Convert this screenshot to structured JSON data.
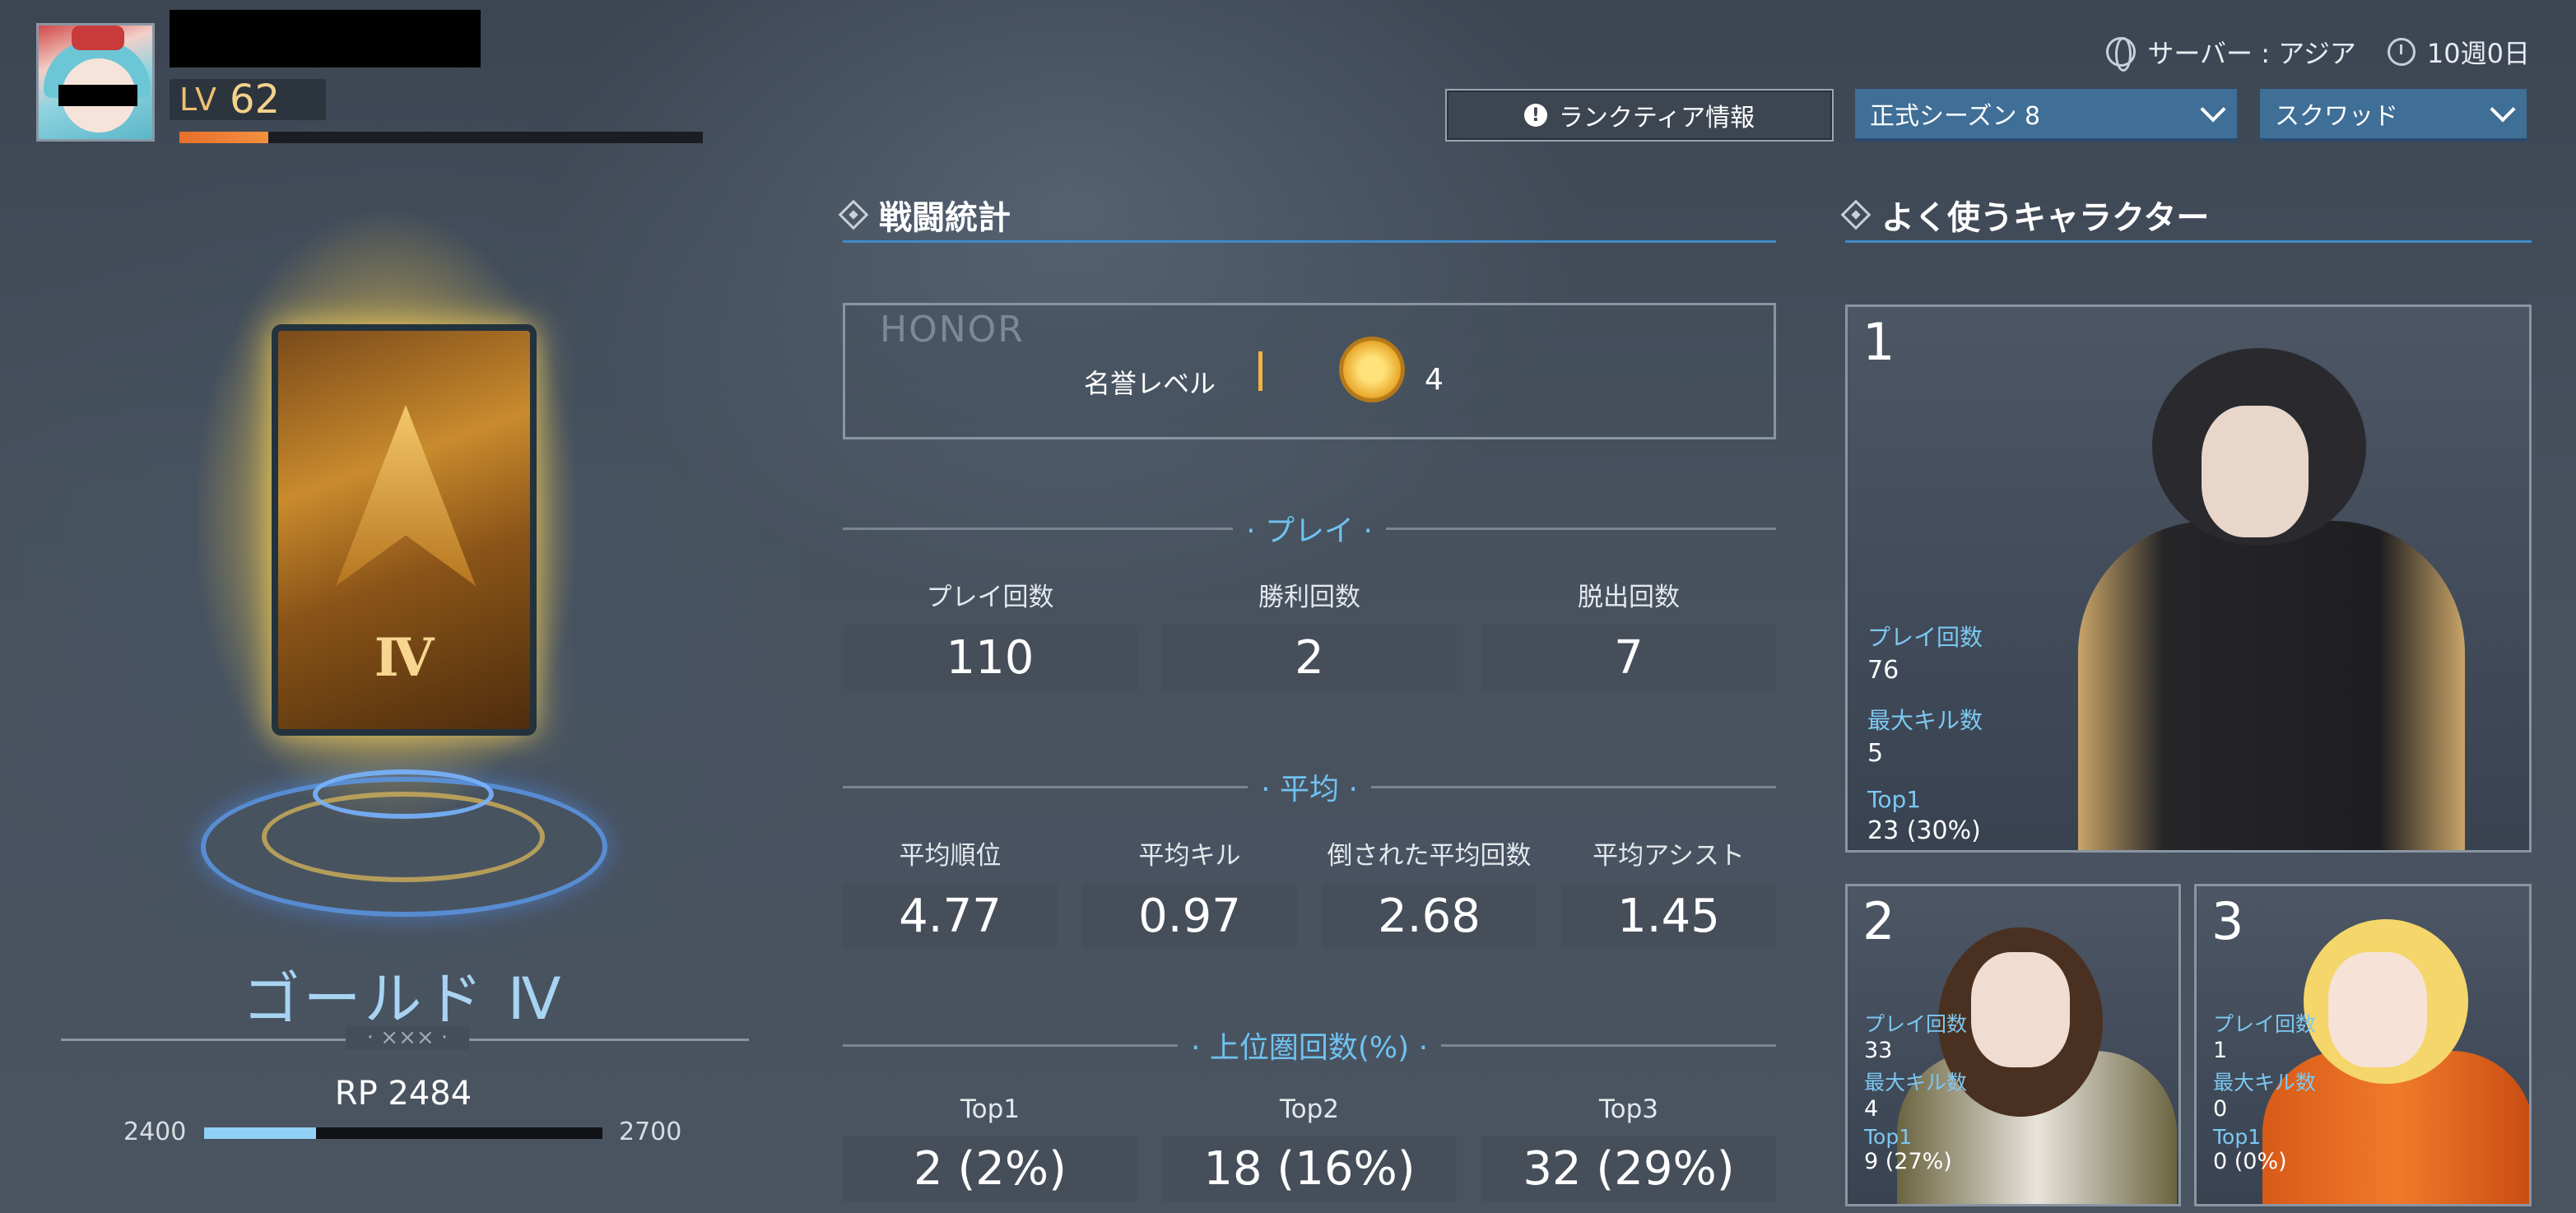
{
  "player": {
    "level_label": "LV",
    "level": "62",
    "xp_progress": 0.17
  },
  "header": {
    "server": "サーバー : アジア",
    "season_time": "10週0日",
    "rank_tier_button": "ランクティア情報",
    "season_select": "正式シーズン 8",
    "mode_select": "スクワッド"
  },
  "rank": {
    "card_numeral": "Ⅳ",
    "name": "ゴールド Ⅳ",
    "divider": "· ××× ·",
    "rp": "RP 2484",
    "rp_min": "2400",
    "rp_max": "2700",
    "rp_progress": 0.28
  },
  "stats": {
    "title": "戦闘統計",
    "honor_tag": "HONOR",
    "honor_label": "名誉レベル",
    "honor_level": "4",
    "play_section": "· プレイ ·",
    "play": [
      {
        "label": "プレイ回数",
        "value": "110"
      },
      {
        "label": "勝利回数",
        "value": "2"
      },
      {
        "label": "脱出回数",
        "value": "7"
      }
    ],
    "avg_section": "· 平均 ·",
    "avg": [
      {
        "label": "平均順位",
        "value": "4.77"
      },
      {
        "label": "平均キル",
        "value": "0.97"
      },
      {
        "label": "倒された平均回数",
        "value": "2.68"
      },
      {
        "label": "平均アシスト",
        "value": "1.45"
      }
    ],
    "top_section": "· 上位圏回数(%) ·",
    "top": [
      {
        "label": "Top1",
        "value": "2 (2%)"
      },
      {
        "label": "Top2",
        "value": "18 (16%)"
      },
      {
        "label": "Top3",
        "value": "32 (29%)"
      }
    ]
  },
  "characters": {
    "title": "よく使うキャラクター",
    "play_label": "プレイ回数",
    "maxkill_label": "最大キル数",
    "top1_label": "Top1",
    "list": [
      {
        "rank": "1",
        "plays": "76",
        "max_kills": "5",
        "top1": "23 (30%)"
      },
      {
        "rank": "2",
        "plays": "33",
        "max_kills": "4",
        "top1": "9 (27%)"
      },
      {
        "rank": "3",
        "plays": "1",
        "max_kills": "0",
        "top1": "0 (0%)"
      }
    ]
  },
  "colors": {
    "accent_blue": "#3f6e97",
    "rank_text": "#a8d4f4",
    "stat_label_blue": "#6fc2f0",
    "xp_orange": "#e8702a",
    "level_gold": "#f4d28a"
  }
}
